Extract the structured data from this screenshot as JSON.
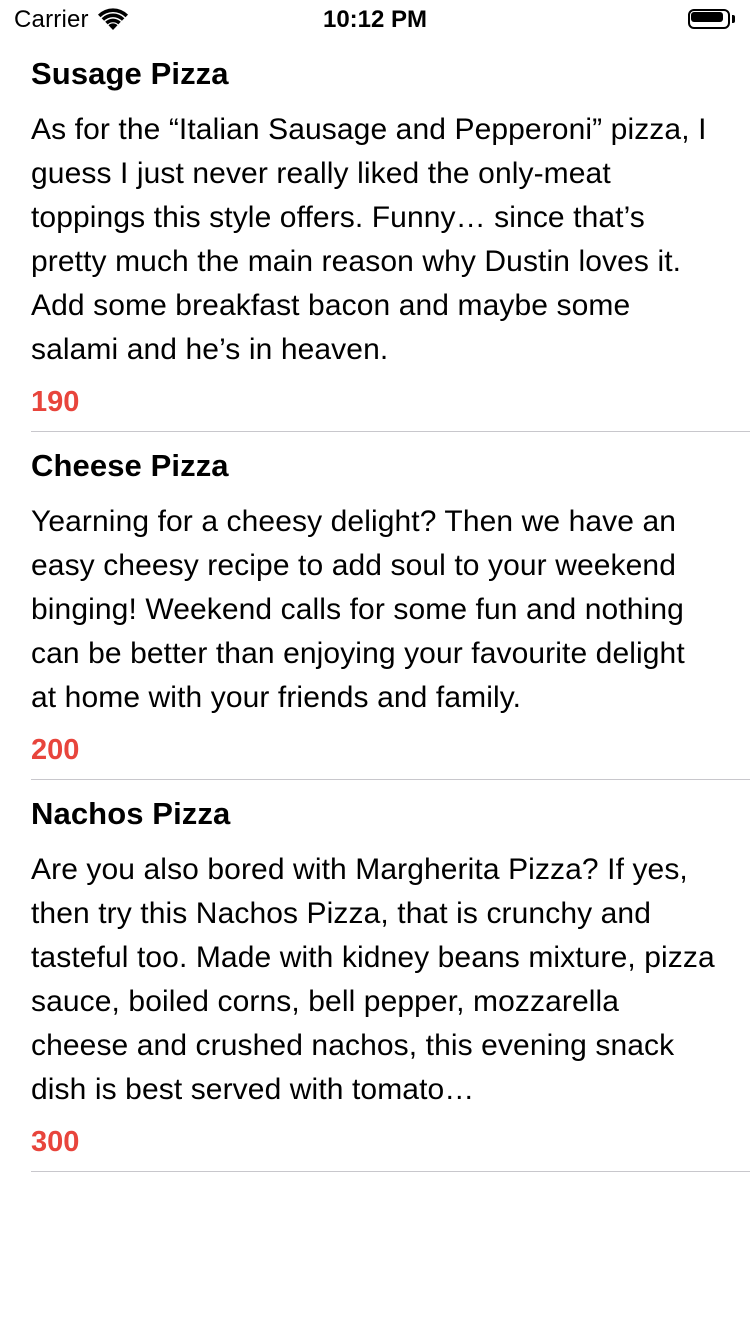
{
  "status_bar": {
    "carrier": "Carrier",
    "time": "10:12 PM"
  },
  "items": [
    {
      "title": "Susage Pizza",
      "description": "As for the “Italian Sausage and Pepperoni” pizza, I guess I just never really liked the only-meat toppings this style offers.  Funny… since that’s pretty much the main reason why Dustin loves it. Add some breakfast bacon and maybe some salami and he’s in heaven.",
      "price": "190"
    },
    {
      "title": "Cheese Pizza",
      "description": "Yearning for a cheesy delight? Then we have an easy cheesy recipe to add soul to your weekend binging! Weekend calls for some fun and nothing can be better than enjoying your favourite delight at home with your friends and family.",
      "price": "200"
    },
    {
      "title": "Nachos Pizza",
      "description": "Are you also bored with Margherita Pizza? If yes, then try this Nachos Pizza, that is crunchy and tasteful too. Made with kidney beans mixture, pizza sauce, boiled corns, bell pepper, mozzarella cheese and crushed nachos, this evening snack dish is best served with tomato…",
      "price": "300"
    }
  ],
  "colors": {
    "price": "#e8453c",
    "separator": "#c8c7cc"
  }
}
